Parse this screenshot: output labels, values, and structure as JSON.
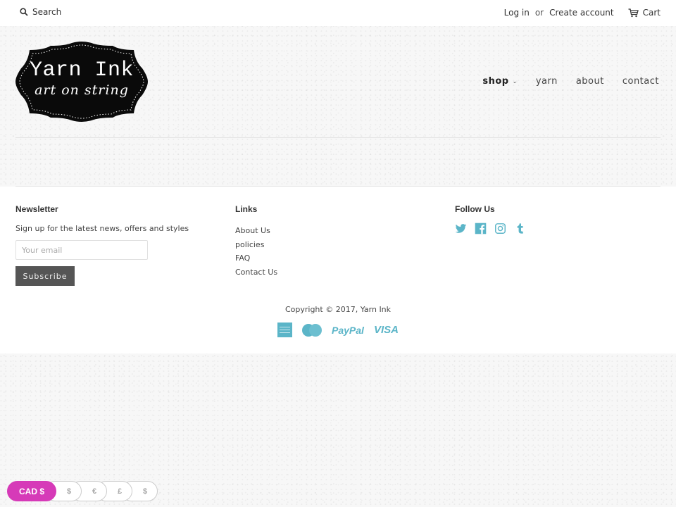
{
  "topbar": {
    "search_label": "Search",
    "login_label": "Log in",
    "or_label": "or",
    "create_account_label": "Create account",
    "cart_label": "Cart"
  },
  "logo": {
    "title": "Yarn Ink",
    "tagline": "art on string"
  },
  "nav": {
    "items": [
      {
        "label": "shop",
        "active": true,
        "has_dropdown": true
      },
      {
        "label": "yarn"
      },
      {
        "label": "about"
      },
      {
        "label": "contact"
      }
    ]
  },
  "footer": {
    "newsletter": {
      "heading": "Newsletter",
      "text": "Sign up for the latest news, offers and styles",
      "email_placeholder": "Your email",
      "email_value": "",
      "subscribe_label": "Subscribe"
    },
    "links": {
      "heading": "Links",
      "items": [
        "About Us",
        "policies",
        "FAQ",
        "Contact Us"
      ]
    },
    "follow": {
      "heading": "Follow Us",
      "icons": [
        "twitter-icon",
        "facebook-icon",
        "instagram-icon",
        "tumblr-icon"
      ],
      "icon_color": "#5bb5c8"
    },
    "copyright": "Copyright © 2017, Yarn Ink",
    "payments": {
      "icons": [
        "american-express-icon",
        "mastercard-icon",
        "paypal-icon",
        "visa-icon"
      ],
      "paypal_label": "PayPal",
      "visa_label": "VISA"
    }
  },
  "currency": {
    "options": [
      "CAD $",
      "$",
      "€",
      "£",
      "$"
    ],
    "selected": "CAD $",
    "accent_color": "#d63ab8"
  }
}
